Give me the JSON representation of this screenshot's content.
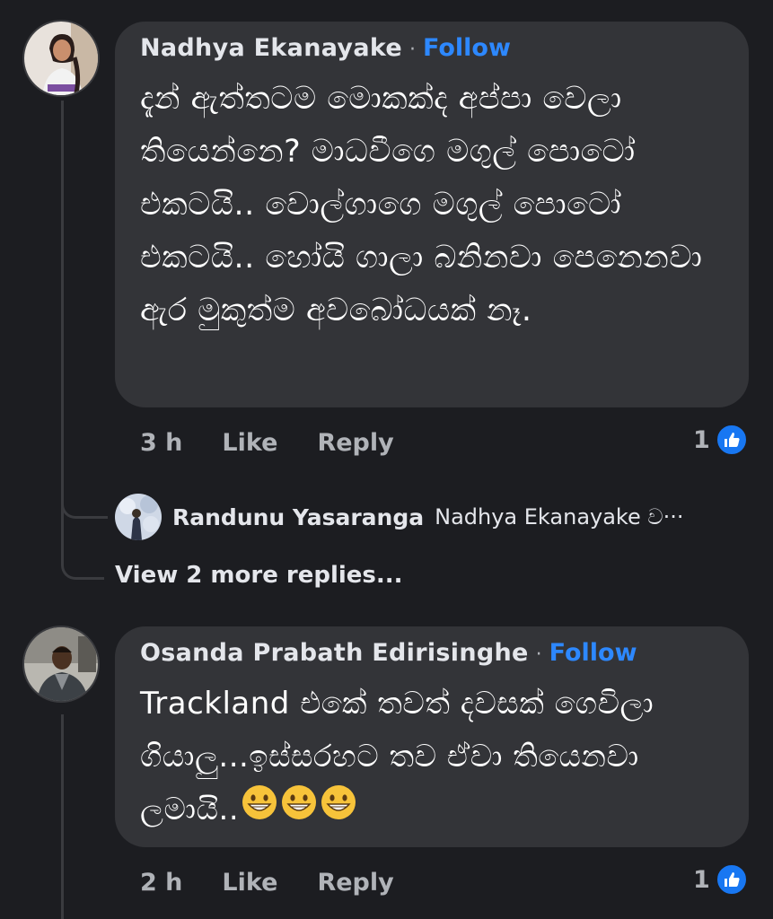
{
  "comments": [
    {
      "author": "Nadhya Ekanayake",
      "follow_label": "Follow",
      "separator": "·",
      "text": "දැන් ඇත්තටම මොකක්ද අප්පා වෙලා තියෙන්නෙ? මාධවීගෙ මගුල් පොටෝ එකටයි.. වොල්ගාගෙ මගුල් පොටෝ එකටයි.. හෝයි ගාලා බනිනවා පෙනෙනවා ඇර මුකුත්ම අවබෝධයක් නෑ.",
      "time": "3 h",
      "like_label": "Like",
      "reply_label": "Reply",
      "reaction_count": "1",
      "reaction_icon": "like-icon"
    },
    {
      "author": "Osanda Prabath Edirisinghe",
      "follow_label": "Follow",
      "separator": "·",
      "text": "Trackland එකේ තවත් දවසක් ගෙවිලා ගියාලු...ඉස්සරහට තව ඒවා තියෙනවා ලමායි..",
      "emojis": [
        "grinning-face",
        "grinning-face",
        "grinning-face"
      ],
      "time": "2 h",
      "like_label": "Like",
      "reply_label": "Reply",
      "reaction_count": "1",
      "reaction_icon": "like-icon"
    }
  ],
  "reply_preview": {
    "author": "Randunu Yasaranga",
    "snippet": "Nadhya Ekanayake ව···"
  },
  "view_more_replies": "View 2 more replies...",
  "colors": {
    "background": "#1c1d21",
    "bubble": "#333438",
    "follow": "#2d88ff",
    "like_badge": "#1877f2",
    "secondary_text": "#b0b3b8"
  }
}
